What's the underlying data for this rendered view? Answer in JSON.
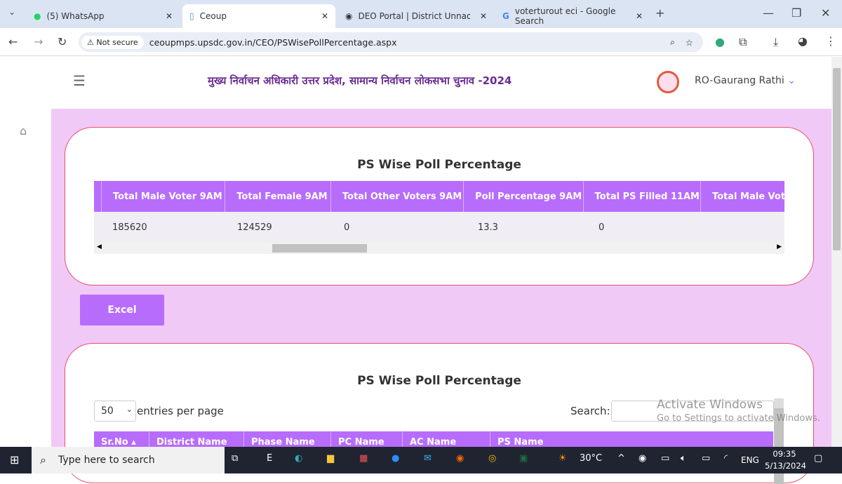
{
  "browser": {
    "tabs": [
      {
        "label": "(5) WhatsApp"
      },
      {
        "label": "Ceoup"
      },
      {
        "label": "DEO Portal | District Unnao, Gov"
      },
      {
        "label": "voterturout eci - Google Search"
      }
    ],
    "security_label": "Not secure",
    "url": "ceoupmps.upsdc.gov.in/CEO/PSWisePollPercentage.aspx"
  },
  "header": {
    "title": "मुख्य निर्वाचन अधिकारी उत्तर प्रदेश, सामान्य निर्वाचन लोकसभा चुनाव -2024",
    "user": "RO-Gaurang Rathi"
  },
  "summary": {
    "title": "PS Wise Poll Percentage",
    "columns": [
      "Total Male Voter 9AM",
      "Total Female 9AM",
      "Total Other Voters 9AM",
      "Poll Percentage 9AM",
      "Total PS Filled 11AM",
      "Total Male Vot"
    ],
    "row": [
      "185620",
      "124529",
      "0",
      "13.3",
      "0",
      ""
    ]
  },
  "excel_label": "Excel",
  "detail": {
    "title": "PS Wise Poll Percentage",
    "page_size": "50",
    "entries_label": "entries per page",
    "search_label": "Search:",
    "columns": [
      "Sr.No",
      "District Name",
      "Phase Name",
      "PC Name",
      "AC Name",
      "PS Name"
    ]
  },
  "watermark": {
    "line1": "Activate Windows",
    "line2": "Go to Settings to activate Windows."
  },
  "taskbar": {
    "search_placeholder": "Type here to search",
    "weather": "30°C",
    "lang": "ENG",
    "time": "09:35",
    "date": "5/13/2024"
  },
  "colors": {
    "accent": "#b76cfb",
    "page_bg": "#f0c9f7",
    "card_border": "#e8506e",
    "title": "#6a2c91"
  }
}
